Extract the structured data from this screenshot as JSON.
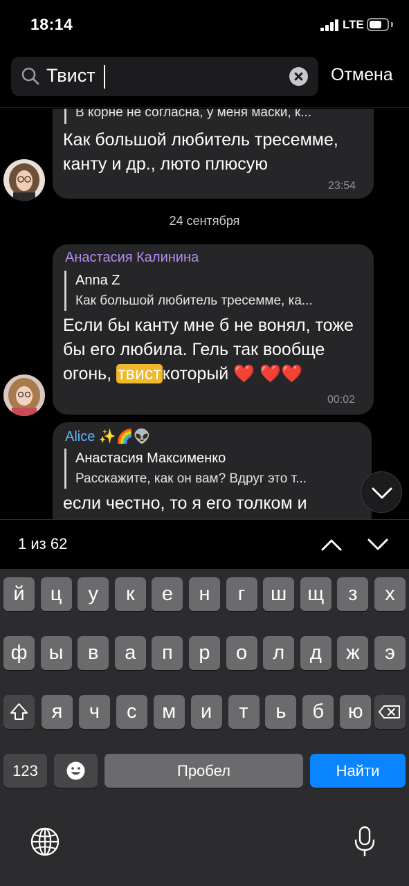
{
  "status_bar": {
    "time": "18:14",
    "network": "LTE",
    "battery_level": 0.7
  },
  "search": {
    "query": "Твист",
    "cancel_label": "Отмена"
  },
  "messages": [
    {
      "reply_text": "В корне не согласна, у меня маски, к...",
      "text": "Как большой любитель тресемме, канту и др., люто плюсую",
      "time": "23:54"
    },
    {
      "sender": "Анастасия Калинина",
      "reply_author": "Anna Z",
      "reply_text": "Как большой любитель тресемме, ка...",
      "text_before": "Если бы канту мне б не вонял, тоже бы его любила. Гель так вообще огонь, ",
      "highlight": "твист",
      "text_after": "который ❤️ ❤️❤️",
      "time": "00:02"
    },
    {
      "sender": "Alice ✨🌈👽",
      "reply_author": "Анастасия Максименко",
      "reply_text": "Расскажите, как он вам? Вдруг это т...",
      "text": "если честно, то я его толком и"
    }
  ],
  "date_separator": "24 сентября",
  "results": {
    "count_label": "1 из 62"
  },
  "keyboard": {
    "row1": [
      "й",
      "ц",
      "у",
      "к",
      "е",
      "н",
      "г",
      "ш",
      "щ",
      "з",
      "х"
    ],
    "row2": [
      "ф",
      "ы",
      "в",
      "а",
      "п",
      "р",
      "о",
      "л",
      "д",
      "ж",
      "э"
    ],
    "row3": [
      "я",
      "ч",
      "с",
      "м",
      "и",
      "т",
      "ь",
      "б",
      "ю"
    ],
    "numbers_label": "123",
    "space_label": "Пробел",
    "action_label": "Найти"
  },
  "colors": {
    "accent": "#0a84ff",
    "highlight": "#f0b82a",
    "sender_purple": "#b68cf0",
    "sender_blue": "#5fb8f5"
  }
}
